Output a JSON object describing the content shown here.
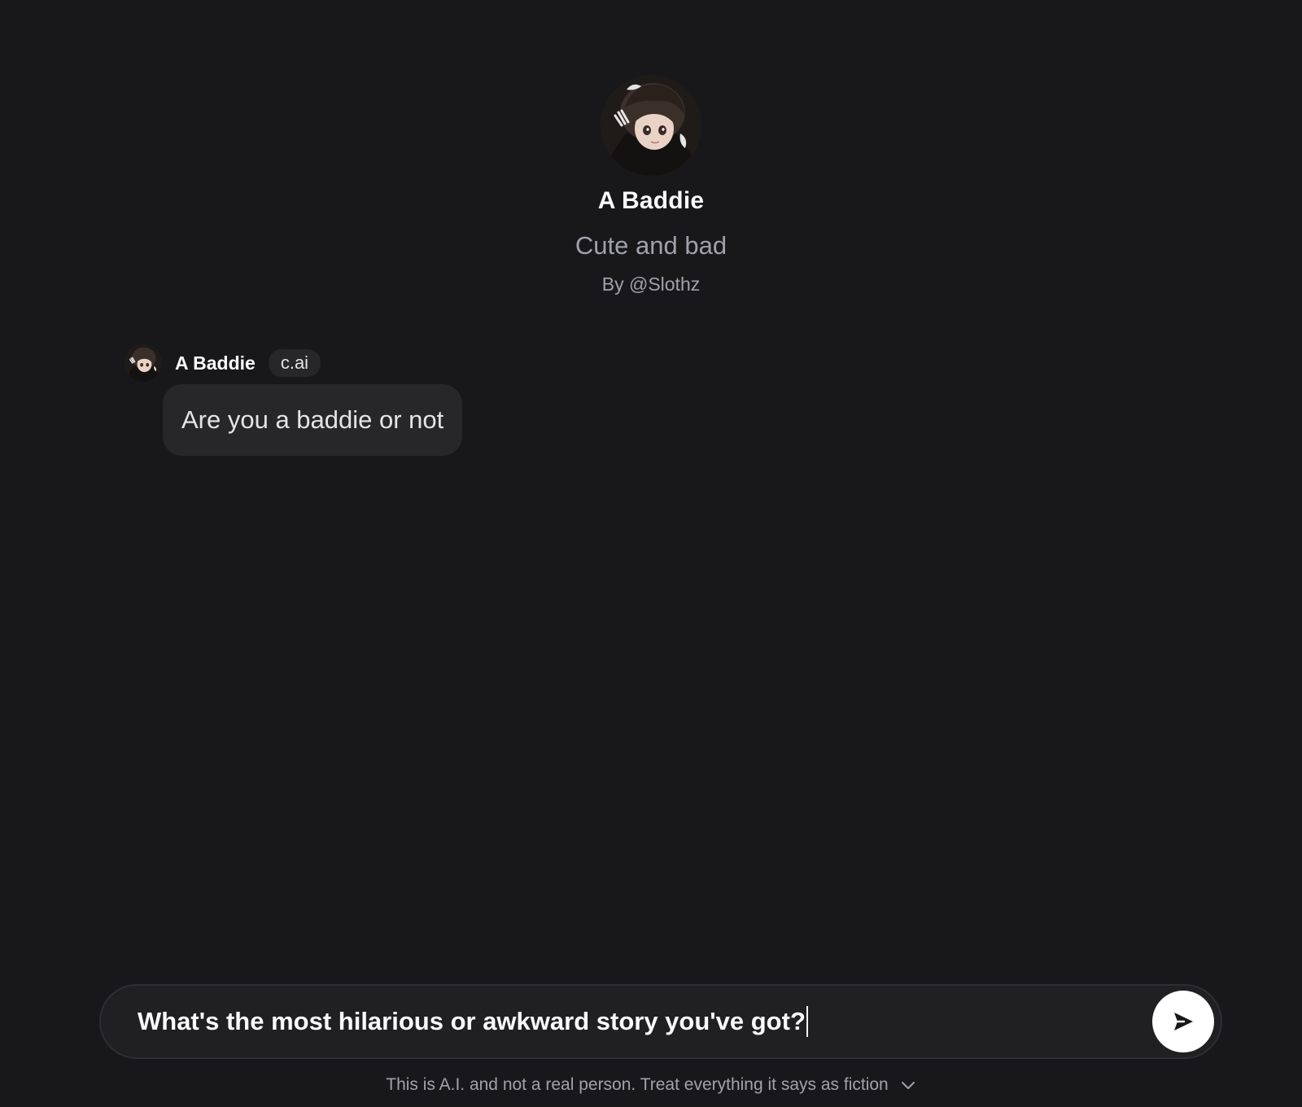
{
  "profile": {
    "name": "A Baddie",
    "tagline": "Cute and bad",
    "author": "By @Slothz"
  },
  "messages": [
    {
      "author": "A Baddie",
      "badge": "c.ai",
      "text": "Are you a baddie or not"
    }
  ],
  "composer": {
    "value": "What's the most hilarious or awkward story you've got?",
    "send_icon": "send-arrow-icon"
  },
  "footer": {
    "disclaimer": "This is A.I. and not a real person. Treat everything it says as fiction",
    "toggle_icon": "chevron-down-icon"
  },
  "colors": {
    "background": "#18181b",
    "bubble": "#27272a",
    "composer": "#202023",
    "muted_text": "#a1a1aa",
    "send_button": "#ffffff"
  }
}
